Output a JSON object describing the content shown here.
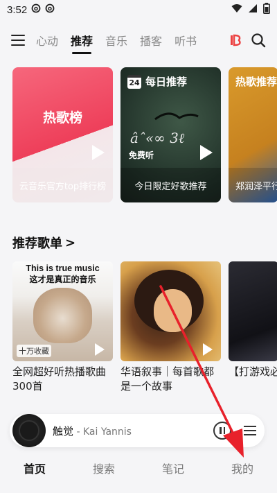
{
  "status_bar": {
    "time": "3:52",
    "notif_icons": [
      "netease-music-notif-icon",
      "netease-music-notif-icon"
    ]
  },
  "top_nav": {
    "tabs": [
      {
        "label": "心动",
        "active": false
      },
      {
        "label": "推荐",
        "active": true
      },
      {
        "label": "音乐",
        "active": false
      },
      {
        "label": "播客",
        "active": false
      },
      {
        "label": "听书",
        "active": false
      }
    ]
  },
  "banners": [
    {
      "title": "热歌榜",
      "caption": "云音乐官方top排行榜"
    },
    {
      "header": "每日推荐",
      "calendar_day": "24",
      "free_label": "免费听",
      "caption": "今日限定好歌推荐"
    },
    {
      "title": "热歌推荐",
      "caption": "郑润泽平行"
    }
  ],
  "section": {
    "title": "推荐歌单",
    "chevron": ">"
  },
  "playlists": [
    {
      "cover_line1": "This is true music",
      "cover_line2": "这才是真正的音乐",
      "badge": "十万收藏",
      "name": "全网超好听热播歌曲300首"
    },
    {
      "name": "华语叙事｜每首歌都是一个故事"
    },
    {
      "name": "【打游戏必燃BGM"
    }
  ],
  "mini_player": {
    "song": "触觉",
    "artist": " - Kai Yannis"
  },
  "bottom_nav": [
    {
      "label": "首页",
      "active": true
    },
    {
      "label": "搜索",
      "active": false
    },
    {
      "label": "笔记",
      "active": false
    },
    {
      "label": "我的",
      "active": false
    }
  ],
  "colors": {
    "annotation_arrow": "#e8212b",
    "brand_red": "#ec4141"
  }
}
